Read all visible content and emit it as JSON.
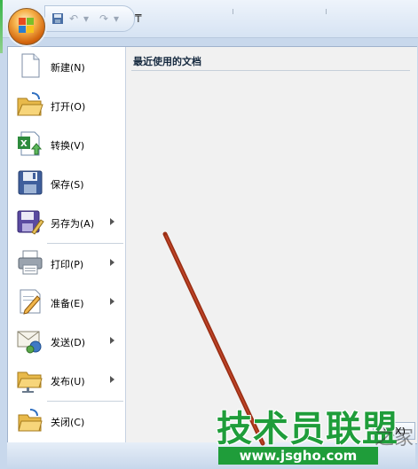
{
  "menu": {
    "recent_title": "最近使用的文档",
    "items": [
      {
        "label": "新建(N)",
        "icon": "new-document-icon",
        "has_submenu": false
      },
      {
        "label": "打开(O)",
        "icon": "open-folder-icon",
        "has_submenu": false
      },
      {
        "label": "转换(V)",
        "icon": "convert-excel-icon",
        "has_submenu": false
      },
      {
        "label": "保存(S)",
        "icon": "save-disk-icon",
        "has_submenu": false
      },
      {
        "label": "另存为(A)",
        "icon": "save-as-icon",
        "has_submenu": true
      },
      {
        "label": "打印(P)",
        "icon": "printer-icon",
        "has_submenu": true
      },
      {
        "label": "准备(E)",
        "icon": "prepare-pencil-icon",
        "has_submenu": true
      },
      {
        "label": "发送(D)",
        "icon": "send-mail-icon",
        "has_submenu": true
      },
      {
        "label": "发布(U)",
        "icon": "publish-folder-icon",
        "has_submenu": true
      },
      {
        "label": "关闭(C)",
        "icon": "close-folder-icon",
        "has_submenu": false
      }
    ]
  },
  "bottom": {
    "exit_label": "cel(X)"
  },
  "watermark": {
    "title": "技术员联盟",
    "url": "www.jsgho.com",
    "suffix": "之家"
  },
  "colors": {
    "accent_green": "#1f9d3a",
    "annotation_arrow": "#9b2f14",
    "office_orange": "#e07a1f"
  }
}
